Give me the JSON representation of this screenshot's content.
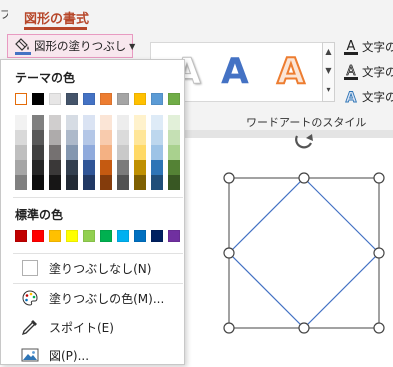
{
  "ribbon": {
    "tab_ghost": "プ",
    "tab_active": "図形の書式",
    "fill_button": "図形の塗りつぶし",
    "wordart": {
      "glyphs": [
        "A",
        "A",
        "A"
      ],
      "colors": [
        "#ffffff",
        "#4472c4",
        "#ed7d31"
      ],
      "caption": "ワードアートのスタイル"
    },
    "text_format_items": [
      "文字の",
      "文字の",
      "文字の"
    ]
  },
  "menu": {
    "theme_header": "テーマの色",
    "theme_top": [
      "#ffffff",
      "#000000",
      "#e7e6e6",
      "#44546a",
      "#4472c4",
      "#ed7d31",
      "#a5a5a5",
      "#ffc000",
      "#5b9bd5",
      "#70ad47"
    ],
    "theme_shades": [
      [
        "#f2f2f2",
        "#d9d9d9",
        "#bfbfbf",
        "#a6a6a6",
        "#808080"
      ],
      [
        "#7f7f7f",
        "#595959",
        "#404040",
        "#262626",
        "#0d0d0d"
      ],
      [
        "#d0cece",
        "#aeabab",
        "#757171",
        "#3a3838",
        "#171616"
      ],
      [
        "#d6dce4",
        "#adb9ca",
        "#8497b0",
        "#333f4f",
        "#222a35"
      ],
      [
        "#dae3f3",
        "#b4c7e7",
        "#8faadc",
        "#2f5597",
        "#203864"
      ],
      [
        "#fbe5d6",
        "#f8cbad",
        "#f4b183",
        "#c55a11",
        "#843c0c"
      ],
      [
        "#ededed",
        "#dbdbdb",
        "#c9c9c9",
        "#7b7b7b",
        "#525252"
      ],
      [
        "#fff2cc",
        "#ffe699",
        "#ffd966",
        "#bf9000",
        "#7f6000"
      ],
      [
        "#deebf7",
        "#bdd7ee",
        "#9dc3e6",
        "#2e75b6",
        "#1f4e79"
      ],
      [
        "#e2f0d9",
        "#c5e0b4",
        "#a9d18e",
        "#548235",
        "#385723"
      ]
    ],
    "standard_header": "標準の色",
    "standard": [
      "#c00000",
      "#ff0000",
      "#ffc000",
      "#ffff00",
      "#92d050",
      "#00b050",
      "#00b0f0",
      "#0070c0",
      "#002060",
      "#7030a0"
    ],
    "items": {
      "no_fill": "塗りつぶしなし(N)",
      "more_colors": "塗りつぶしの色(M)...",
      "eyedropper": "スポイト(E)",
      "picture": "図(P)..."
    }
  },
  "icons": {
    "fill": "paint-bucket-icon",
    "dropdown": "chevron-down-icon",
    "palette": "palette-icon",
    "eyedropper": "eyedropper-icon",
    "picture": "picture-icon",
    "text_fill": "text-fill-icon",
    "text_outline": "text-outline-icon",
    "text_effects": "text-effects-icon",
    "rotate": "rotate-handle-icon"
  },
  "colors": {
    "accent": "#b7472a",
    "highlight_border": "#e89ac1",
    "shape_line": "#4472c4"
  }
}
